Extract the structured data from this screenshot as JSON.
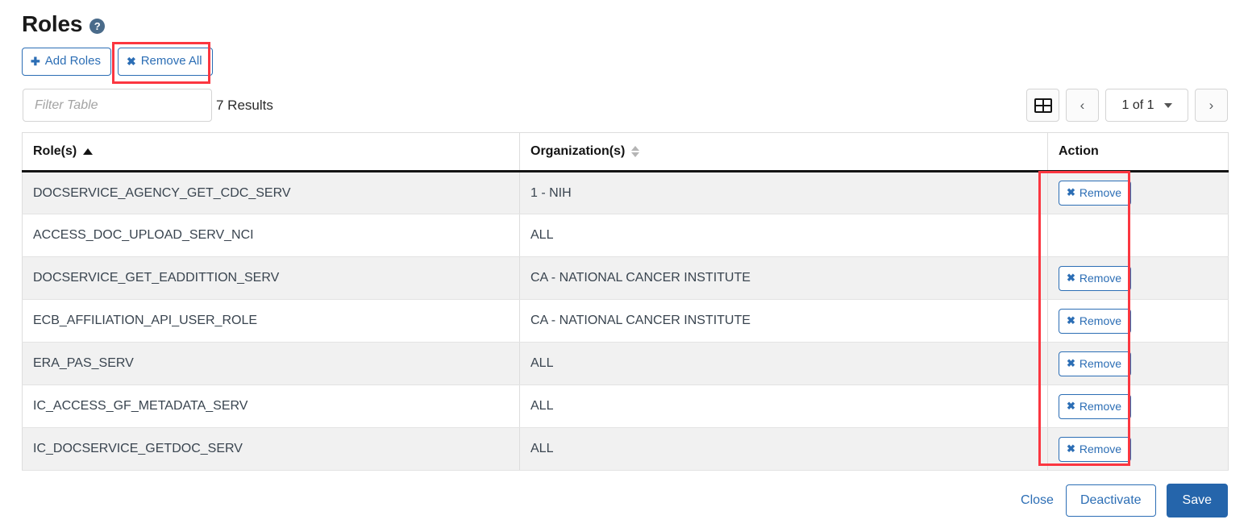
{
  "header": {
    "title": "Roles",
    "help_icon": "question-circle-icon"
  },
  "toolbar": {
    "add_roles_label": "Add Roles",
    "add_roles_icon": "plus-icon",
    "remove_all_label": "Remove All",
    "remove_all_icon": "x-mark-icon"
  },
  "filter": {
    "value": "",
    "placeholder": "Filter Table",
    "results_text": "7 Results"
  },
  "pagination": {
    "grid_view_icon": "grid-view-icon",
    "prev_label": "‹",
    "next_label": "›",
    "page_label": "1 of 1",
    "dropdown_icon": "chevron-down-icon"
  },
  "table": {
    "columns": [
      {
        "label": "Role(s)",
        "sort": "asc"
      },
      {
        "label": "Organization(s)",
        "sort": "none"
      },
      {
        "label": "Action",
        "sort": "none"
      }
    ],
    "remove_label": "Remove",
    "remove_icon": "x-mark-icon",
    "rows": [
      {
        "role": "DOCSERVICE_AGENCY_GET_CDC_SERV",
        "organization": "1 - NIH",
        "has_remove": true
      },
      {
        "role": "ACCESS_DOC_UPLOAD_SERV_NCI",
        "organization": "ALL",
        "has_remove": false
      },
      {
        "role": "DOCSERVICE_GET_EADDITTION_SERV",
        "organization": "CA - NATIONAL CANCER INSTITUTE",
        "has_remove": true
      },
      {
        "role": "ECB_AFFILIATION_API_USER_ROLE",
        "organization": "CA - NATIONAL CANCER INSTITUTE",
        "has_remove": true
      },
      {
        "role": "ERA_PAS_SERV",
        "organization": "ALL",
        "has_remove": true
      },
      {
        "role": "IC_ACCESS_GF_METADATA_SERV",
        "organization": "ALL",
        "has_remove": true
      },
      {
        "role": "IC_DOCSERVICE_GETDOC_SERV",
        "organization": "ALL",
        "has_remove": true
      }
    ]
  },
  "footer": {
    "close_label": "Close",
    "deactivate_label": "Deactivate",
    "save_label": "Save"
  },
  "colors": {
    "accent_blue": "#2c6eb5",
    "primary_blue": "#2565ab",
    "highlight_red": "#fb3640",
    "row_stripe": "#f1f1f1"
  }
}
